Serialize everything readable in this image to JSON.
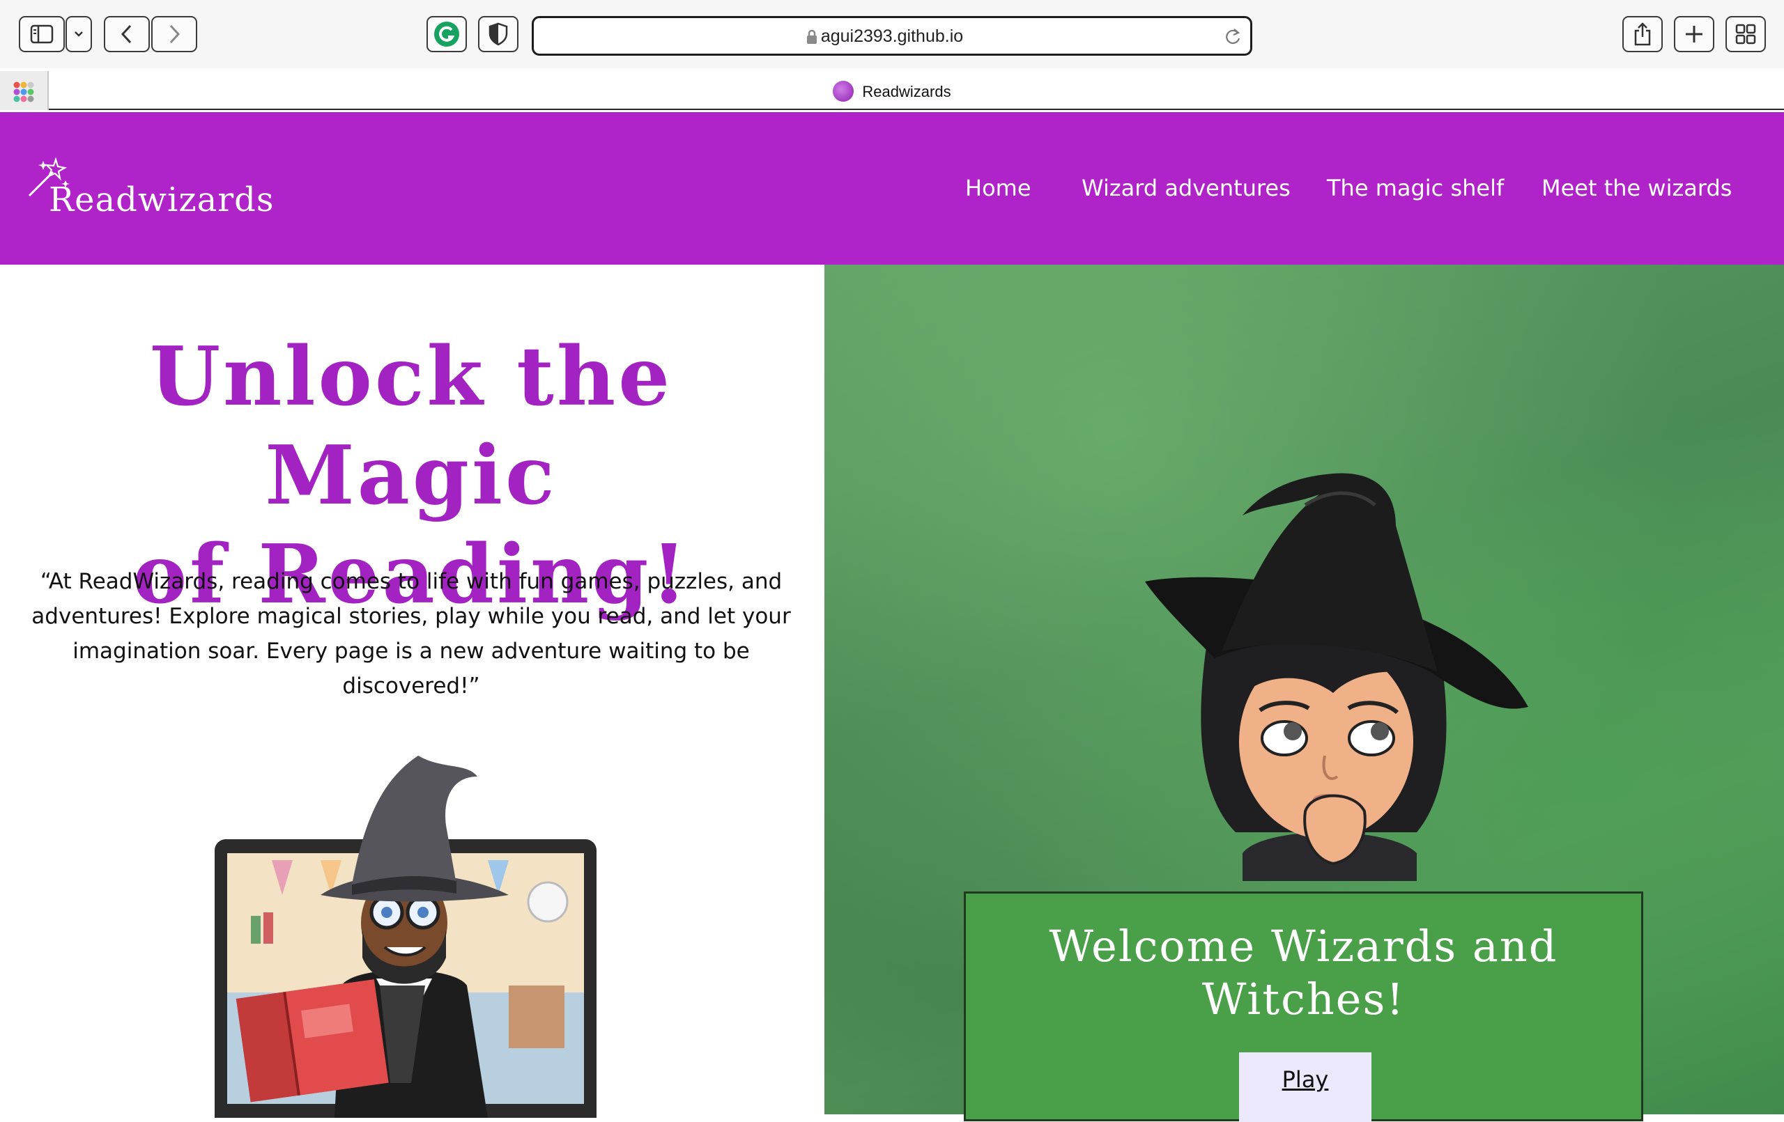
{
  "browser": {
    "url": "agui2393.github.io",
    "tab_title": "Readwizards",
    "icons": [
      "sidebar-icon",
      "chevron-down-icon",
      "back-icon",
      "forward-icon",
      "grammarly-icon",
      "shield-icon",
      "lock-icon",
      "reload-icon",
      "share-icon",
      "new-tab-icon",
      "tab-overview-icon",
      "tab-groups-icon"
    ]
  },
  "header": {
    "logo": "Readwizards",
    "nav": [
      "Home",
      "Wizard adventures",
      "The magic shelf",
      "Meet the wizards"
    ],
    "background": "#b023c9"
  },
  "hero": {
    "title_line1": "Unlock the Magic",
    "title_line2": "of Reading!",
    "quote": "“At ReadWizards, reading comes to life with fun games, puzzles, and adventures! Explore magical stories, play while you read, and let your imagination soar. Every page is a new adventure waiting to be discovered!”",
    "title_color": "#a323c2"
  },
  "welcome": {
    "heading_line1": "Welcome Wizards and",
    "heading_line2": "Witches!",
    "play_label": "Play",
    "box_color": "#4aa049"
  }
}
